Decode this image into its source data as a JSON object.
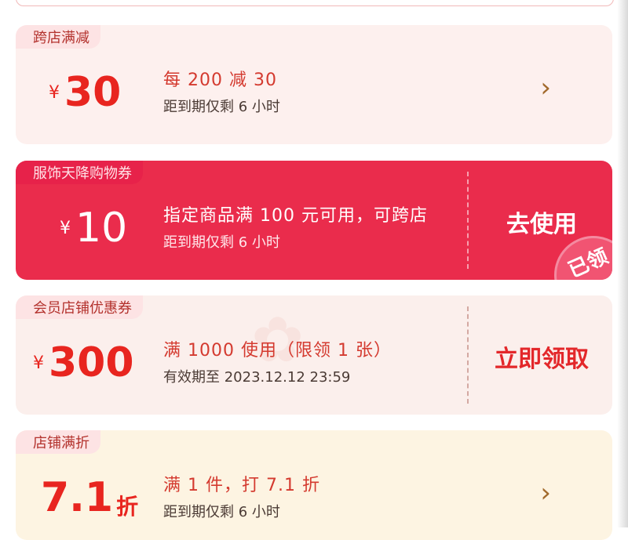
{
  "coupons": [
    {
      "tag": "跨店满减",
      "currency": "¥",
      "amount": "30",
      "condition": "每 200 减 30",
      "expiry": "距到期仅剩 6 小时",
      "action_icon": "chevron-right-icon",
      "chevron": "›"
    },
    {
      "tag": "服饰天降购物券",
      "currency": "¥",
      "amount": "10",
      "condition": "指定商品满 100 元可用，可跨店",
      "expiry": "距到期仅剩 6 小时",
      "action_label": "去使用",
      "stamp": "已领"
    },
    {
      "tag": "会员店铺优惠券",
      "currency": "¥",
      "amount": "300",
      "condition": "满 1000 使用（限领 1 张）",
      "expiry": "有效期至 2023.12.12 23:59",
      "action_label": "立即领取"
    },
    {
      "tag": "店铺满折",
      "amount": "7.1",
      "unit": "折",
      "condition": "满 1 件，打 7.1 折",
      "expiry": "距到期仅剩 6 小时",
      "action_icon": "chevron-right-icon",
      "chevron": "›"
    }
  ],
  "colors": {
    "accent_red": "#e8251f",
    "card_red": "#ea2c4c",
    "light_bg": "#fdf0ee",
    "yellow_bg": "#fdf4e2"
  }
}
